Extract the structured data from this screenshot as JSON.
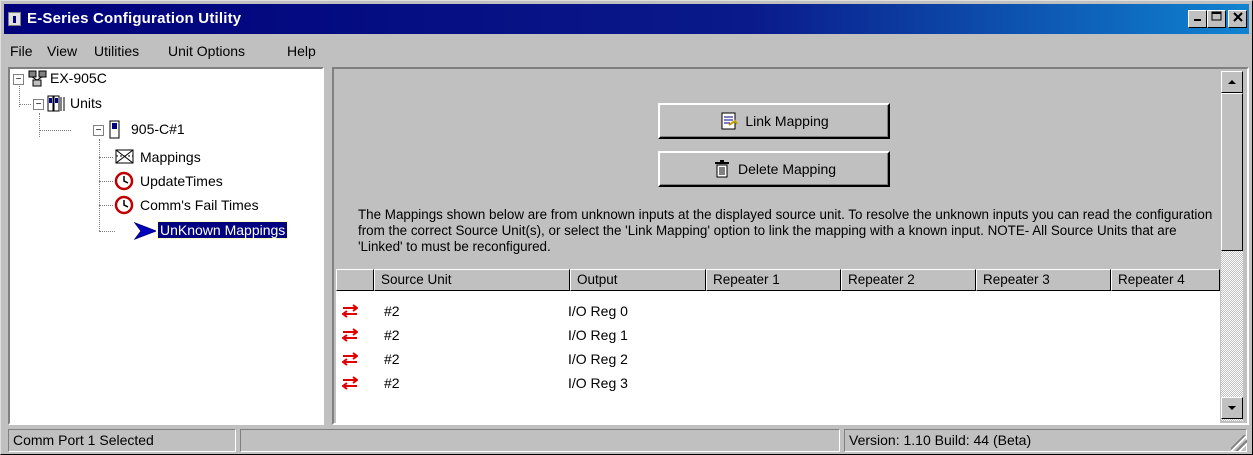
{
  "window": {
    "title": "E-Series Configuration Utility"
  },
  "menu": [
    {
      "label": "File"
    },
    {
      "label": "View"
    },
    {
      "label": "Utilities"
    },
    {
      "label": "Unit Options"
    },
    {
      "label": "Help"
    }
  ],
  "tree": {
    "root": "EX-905C",
    "units": "Units",
    "unit": "905-C#1",
    "mappings": "Mappings",
    "update_times": "UpdateTimes",
    "comm_fail": "Comm's Fail Times",
    "unknown": "UnKnown Mappings"
  },
  "main": {
    "link_button": "Link Mapping",
    "delete_button": "Delete Mapping",
    "info": "The Mappings shown below are from unknown inputs at the displayed source unit. To resolve the unknown inputs you can read the configuration from the correct Source Unit(s), or select the 'Link Mapping' option to link the mapping with a known input. NOTE- All Source Units that are 'Linked' to must be reconfigured."
  },
  "grid": {
    "columns": [
      "",
      "Source Unit",
      "Output",
      "Repeater 1",
      "Repeater 2",
      "Repeater 3",
      "Repeater 4"
    ],
    "rows": [
      {
        "source": "#2",
        "output": "I/O Reg 0"
      },
      {
        "source": "#2",
        "output": "I/O Reg 1"
      },
      {
        "source": "#2",
        "output": "I/O Reg 2"
      },
      {
        "source": "#2",
        "output": "I/O Reg 3"
      }
    ]
  },
  "status": {
    "left": "Comm Port 1 Selected",
    "middle": "",
    "right": "Version: 1.10 Build: 44 (Beta)"
  },
  "colors": {
    "title_start": "#00007b",
    "title_end": "#1084d0",
    "selection": "#000080",
    "face": "#c0c0c0",
    "arrow": "#e00000"
  }
}
